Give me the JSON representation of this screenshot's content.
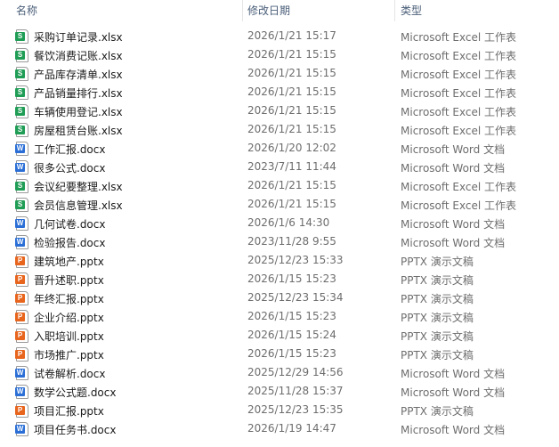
{
  "header": {
    "name": "名称",
    "date": "修改日期",
    "type": "类型"
  },
  "colors": {
    "xlsx": "#1f9d55",
    "docx": "#2b6fd6",
    "pptx": "#e8651d"
  },
  "files": [
    {
      "name": "采购订单记录.xlsx",
      "date": "2026/1/21 15:17",
      "type": "Microsoft Excel 工作表",
      "kind": "xlsx",
      "badge": "S"
    },
    {
      "name": "餐饮消费记账.xlsx",
      "date": "2026/1/21 15:15",
      "type": "Microsoft Excel 工作表",
      "kind": "xlsx",
      "badge": "S"
    },
    {
      "name": "产品库存清单.xlsx",
      "date": "2026/1/21 15:15",
      "type": "Microsoft Excel 工作表",
      "kind": "xlsx",
      "badge": "S"
    },
    {
      "name": "产品销量排行.xlsx",
      "date": "2026/1/21 15:15",
      "type": "Microsoft Excel 工作表",
      "kind": "xlsx",
      "badge": "S"
    },
    {
      "name": "车辆使用登记.xlsx",
      "date": "2026/1/21 15:15",
      "type": "Microsoft Excel 工作表",
      "kind": "xlsx",
      "badge": "S"
    },
    {
      "name": "房屋租赁台账.xlsx",
      "date": "2026/1/21 15:15",
      "type": "Microsoft Excel 工作表",
      "kind": "xlsx",
      "badge": "S"
    },
    {
      "name": "工作汇报.docx",
      "date": "2026/1/20 12:02",
      "type": "Microsoft Word 文档",
      "kind": "docx",
      "badge": "W"
    },
    {
      "name": "很多公式.docx",
      "date": "2023/7/11 11:44",
      "type": "Microsoft Word 文档",
      "kind": "docx",
      "badge": "W"
    },
    {
      "name": "会议纪要整理.xlsx",
      "date": "2026/1/21 15:15",
      "type": "Microsoft Excel 工作表",
      "kind": "xlsx",
      "badge": "S"
    },
    {
      "name": "会员信息管理.xlsx",
      "date": "2026/1/21 15:15",
      "type": "Microsoft Excel 工作表",
      "kind": "xlsx",
      "badge": "S"
    },
    {
      "name": "几何试卷.docx",
      "date": "2026/1/6 14:30",
      "type": "Microsoft Word 文档",
      "kind": "docx",
      "badge": "W"
    },
    {
      "name": "检验报告.docx",
      "date": "2023/11/28 9:55",
      "type": "Microsoft Word 文档",
      "kind": "docx",
      "badge": "W"
    },
    {
      "name": "建筑地产.pptx",
      "date": "2025/12/23 15:33",
      "type": "PPTX 演示文稿",
      "kind": "pptx",
      "badge": "P"
    },
    {
      "name": "晋升述职.pptx",
      "date": "2026/1/15 15:23",
      "type": "PPTX 演示文稿",
      "kind": "pptx",
      "badge": "P"
    },
    {
      "name": "年终汇报.pptx",
      "date": "2025/12/23 15:34",
      "type": "PPTX 演示文稿",
      "kind": "pptx",
      "badge": "P"
    },
    {
      "name": "企业介绍.pptx",
      "date": "2026/1/15 15:23",
      "type": "PPTX 演示文稿",
      "kind": "pptx",
      "badge": "P"
    },
    {
      "name": "入职培训.pptx",
      "date": "2026/1/15 15:24",
      "type": "PPTX 演示文稿",
      "kind": "pptx",
      "badge": "P"
    },
    {
      "name": "市场推广.pptx",
      "date": "2026/1/15 15:23",
      "type": "PPTX 演示文稿",
      "kind": "pptx",
      "badge": "P"
    },
    {
      "name": "试卷解析.docx",
      "date": "2025/12/29 14:56",
      "type": "Microsoft Word 文档",
      "kind": "docx",
      "badge": "W"
    },
    {
      "name": "数学公式题.docx",
      "date": "2025/11/28 15:37",
      "type": "Microsoft Word 文档",
      "kind": "docx",
      "badge": "W"
    },
    {
      "name": "项目汇报.pptx",
      "date": "2025/12/23 15:35",
      "type": "PPTX 演示文稿",
      "kind": "pptx",
      "badge": "P"
    },
    {
      "name": "项目任务书.docx",
      "date": "2026/1/19 14:47",
      "type": "Microsoft Word 文档",
      "kind": "docx",
      "badge": "W"
    }
  ]
}
